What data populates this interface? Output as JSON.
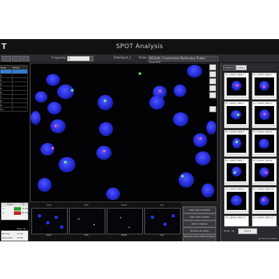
{
  "app": {
    "logo_text": "T",
    "title": "SPOT Analysis"
  },
  "toolbar": {
    "field_label": "Frequency",
    "field_value": "1",
    "file_label": "Slide/Spot_1",
    "probe_label": "Probe",
    "probe_value": "WS2/46 / Centromere Multicolour Probe / Spectral"
  },
  "left_panel": {
    "header": "Slide",
    "column_header": "#Spot",
    "rows": [
      "1",
      "2",
      "3",
      "4",
      "5",
      "6",
      "7",
      "8",
      "9",
      "10"
    ],
    "mini_table": {
      "header_col1": "Score",
      "header_col2": "%",
      "rows": [
        {
          "label": "1",
          "value": "75.0%",
          "status_color": "#2f9e2f"
        },
        {
          "label": "2",
          "value": "25.0%",
          "status_color": "#c42020"
        }
      ]
    },
    "summary": {
      "total_label": "Total: 16",
      "normal_label": "Normal",
      "normal_value": "72.2%",
      "abnormal_label": "Abnormal",
      "abnormal_value": "27.8%"
    }
  },
  "thumbnails": [
    {
      "header": "DAPI",
      "label": "DAPI"
    },
    {
      "header": "FITC",
      "label": "FITC"
    },
    {
      "header": "TRITC",
      "label": "TRITC"
    },
    {
      "header": "Cy5",
      "label": "Cy5"
    }
  ],
  "actions": {
    "buttons": [
      "Clear Signal Outside",
      "Clear Spot Outside",
      "Return Original",
      "Remove All Spots",
      "Remove Spots without Signal"
    ]
  },
  "right_panel": {
    "tabs": [
      "Statistics",
      "Gallery"
    ],
    "gallery_items": [
      "TS_1_24025_13090_1",
      "TS_1_24025_13090_2",
      "TS_1_24025_13090_3",
      "TS_1_24025_13090_4",
      "TS_1_24025_13090_5",
      "TS_1_24025_13090_6",
      "TS_1_24025_13090_7",
      "TS_1_24025_13090_8",
      "TS_1_24025_13090_9",
      "TS_1_24025_13090_10",
      "TS_1_24025_13090_11",
      "TS_1_24025_13090_12"
    ],
    "count_label": "#Cell : 36",
    "export_button": "Export",
    "status": "00:00:10 10.0000"
  },
  "colors": {
    "nucleus": "#2a30e0",
    "signal_green": "#7dff7d",
    "signal_red": "#ff5fd0",
    "selection": "#2f7fd6"
  }
}
